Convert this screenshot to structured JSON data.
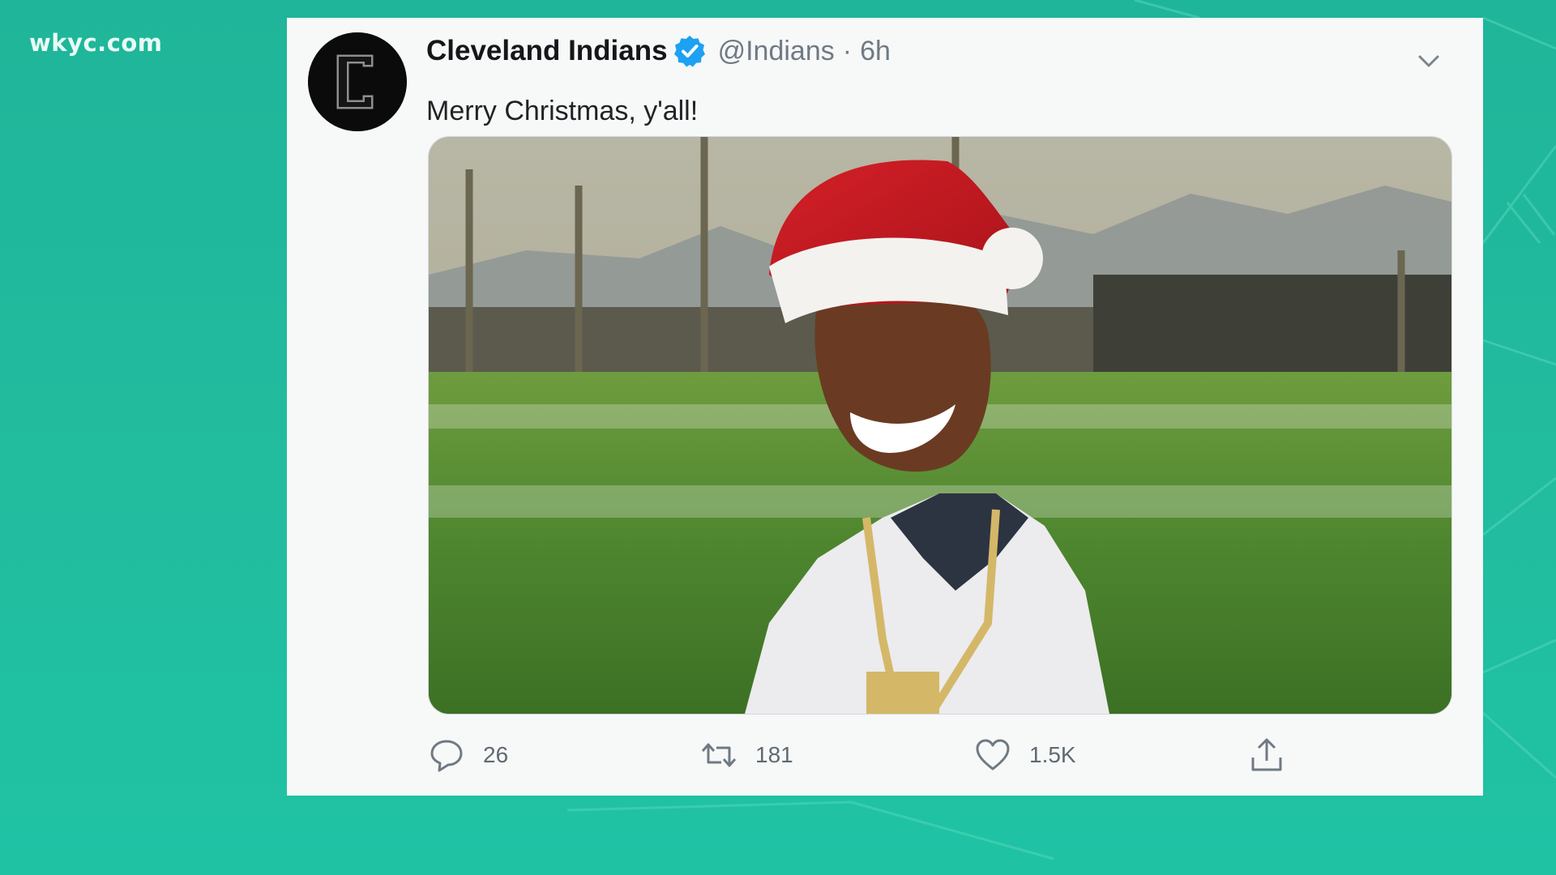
{
  "watermark": "wkyc.com",
  "tweet": {
    "author_name": "Cleveland Indians",
    "handle": "@Indians",
    "separator": "·",
    "time": "6h",
    "text": "Merry Christmas, y'all!",
    "avatar_icon": "team-c-logo-icon",
    "media_description": "photo",
    "actions": {
      "reply_count": "26",
      "retweet_count": "181",
      "like_count": "1.5K"
    }
  },
  "colors": {
    "background": "#22bc9f",
    "card": "#f7f8f8",
    "verified": "#1da1f2",
    "text_secondary": "#6f7a83",
    "santa_hat": "#c8161d"
  }
}
